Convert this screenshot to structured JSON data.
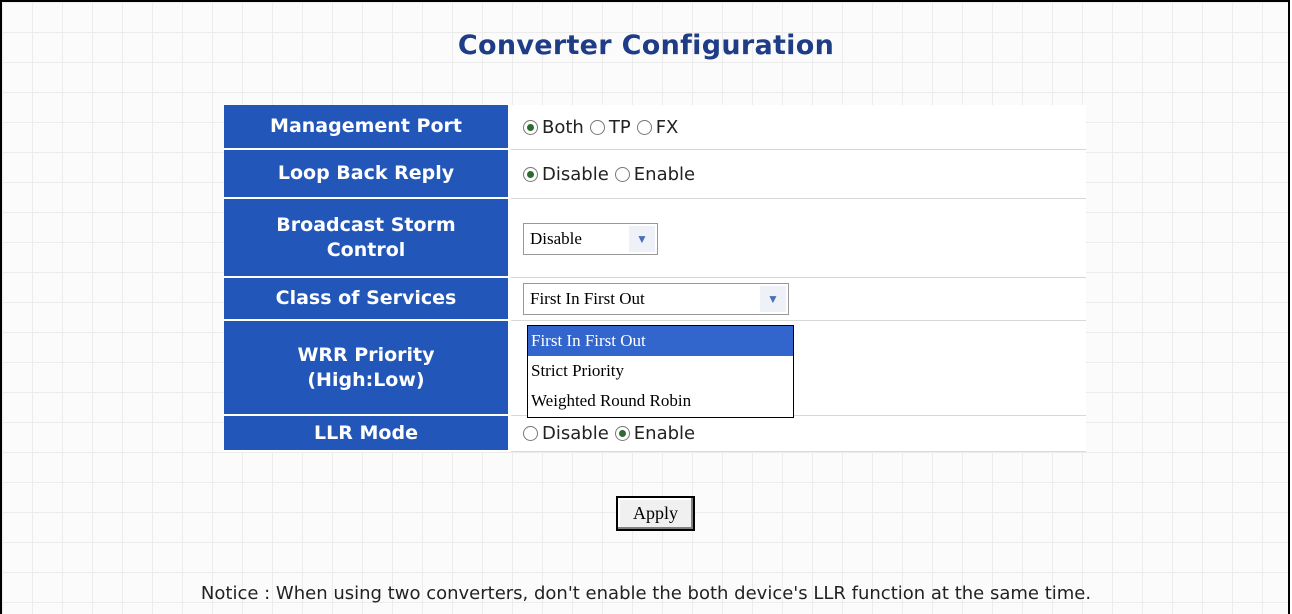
{
  "title": "Converter Configuration",
  "rows": {
    "management_port": {
      "label": "Management Port",
      "options": [
        "Both",
        "TP",
        "FX"
      ],
      "selected": "Both"
    },
    "loop_back_reply": {
      "label": "Loop Back Reply",
      "options": [
        "Disable",
        "Enable"
      ],
      "selected": "Disable"
    },
    "broadcast_storm": {
      "label_line1": "Broadcast Storm",
      "label_line2": "Control",
      "value": "Disable"
    },
    "class_of_services": {
      "label": "Class of Services",
      "value": "First In First Out",
      "dropdown_options": [
        "First In First Out",
        "Strict Priority",
        "Weighted Round Robin"
      ],
      "highlighted_option": "First In First Out"
    },
    "wrr_priority": {
      "label_line1": "WRR Priority",
      "label_line2": "(High:Low)"
    },
    "llr_mode": {
      "label": "LLR Mode",
      "options": [
        "Disable",
        "Enable"
      ],
      "selected": "Enable"
    }
  },
  "apply_label": "Apply",
  "notice": "Notice : When using two converters, don't enable the both device's LLR function at the same time.",
  "colors": {
    "title": "#1f3d86",
    "label_bg": "#2256b8",
    "dropdown_highlight": "#3366cc"
  }
}
